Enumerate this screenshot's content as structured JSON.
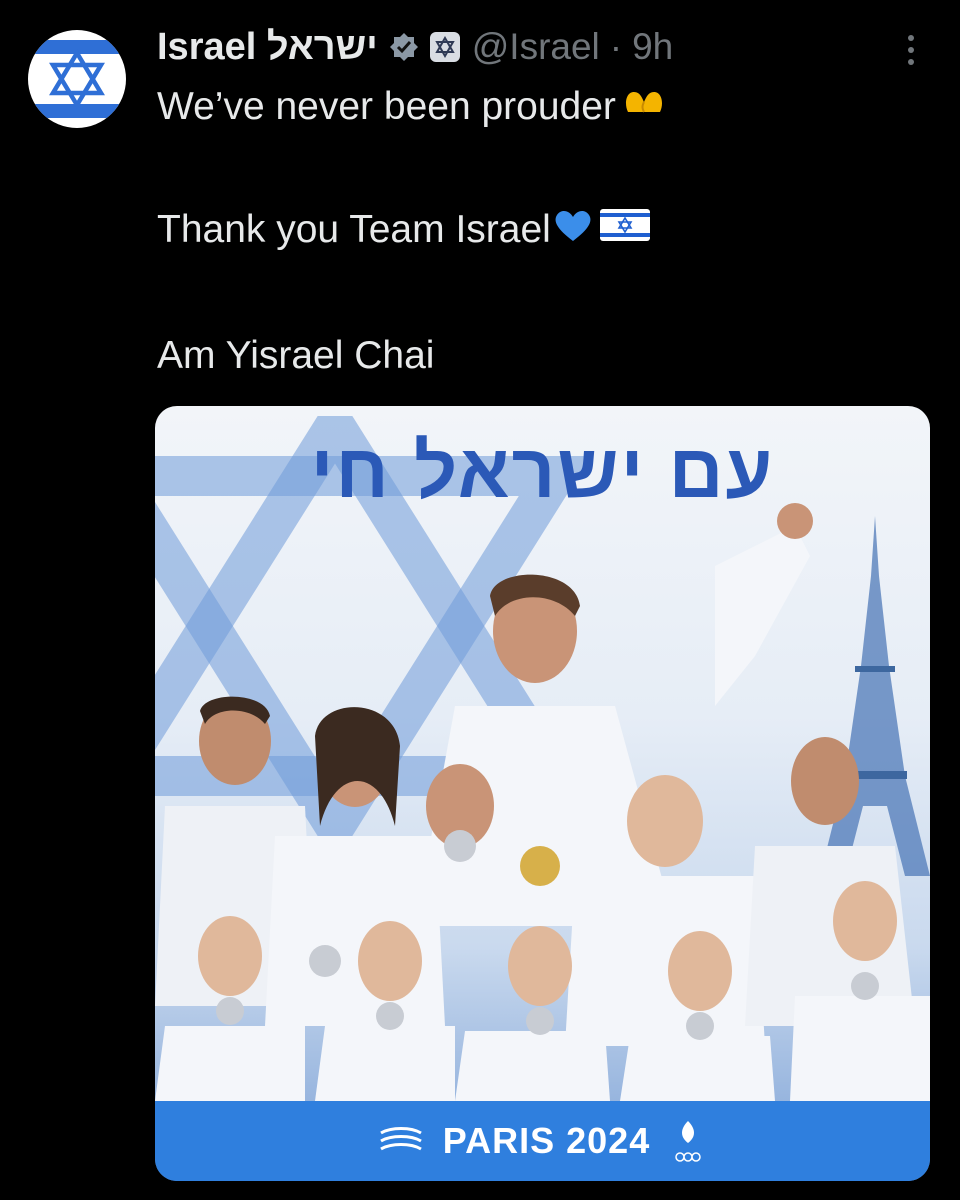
{
  "account": {
    "display_name": "Israel ישראל",
    "handle": "@Israel",
    "separator": "·",
    "time_ago": "9h",
    "verified": true,
    "avatar_icon": "star-of-david-icon",
    "affiliate_icon": "government-badge-icon"
  },
  "post": {
    "line1": "We’ve never been prouder",
    "line1_emoji": "heart-hands-emoji",
    "line2": "Thank you Team Israel",
    "line2_emojis": [
      "blue-heart-emoji",
      "israel-flag-emoji"
    ],
    "line3": "Am Yisrael Chai"
  },
  "media": {
    "banner_text": "עם ישראל חי",
    "footer_text": "PARIS 2024",
    "footer_colors": {
      "bar": "#2f7fde",
      "title": "#2b59b7"
    }
  },
  "colors": {
    "background": "#000000",
    "text": "#e7e9ea",
    "muted": "#71767b",
    "accent": "#2f6fd6"
  }
}
